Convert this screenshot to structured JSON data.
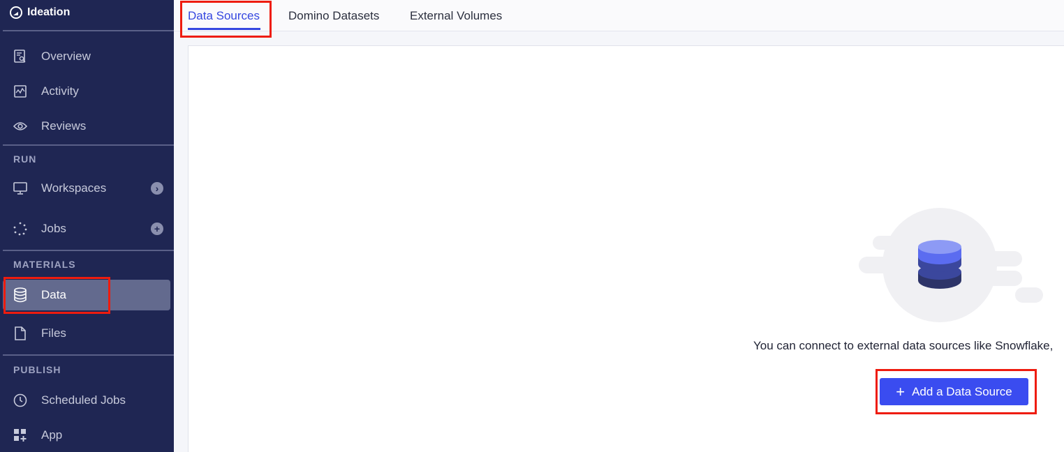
{
  "sidebar": {
    "brand": "Ideation",
    "items_top": [
      {
        "label": "Overview",
        "icon": "overview-icon"
      },
      {
        "label": "Activity",
        "icon": "activity-icon"
      },
      {
        "label": "Reviews",
        "icon": "eye-icon"
      }
    ],
    "sections": {
      "run": "RUN",
      "materials": "MATERIALS",
      "publish": "PUBLISH"
    },
    "run_items": [
      {
        "label": "Workspaces",
        "icon": "monitor-icon",
        "trailing": "chevron-right-icon"
      },
      {
        "label": "Jobs",
        "icon": "jobs-icon",
        "trailing": "plus-icon"
      }
    ],
    "materials_items": [
      {
        "label": "Data",
        "icon": "database-icon",
        "active": true
      },
      {
        "label": "Files",
        "icon": "file-icon"
      }
    ],
    "publish_items": [
      {
        "label": "Scheduled Jobs",
        "icon": "clock-icon"
      },
      {
        "label": "App",
        "icon": "app-icon"
      }
    ]
  },
  "tabs": [
    {
      "label": "Data Sources",
      "active": true
    },
    {
      "label": "Domino Datasets",
      "active": false
    },
    {
      "label": "External Volumes",
      "active": false
    }
  ],
  "empty_state": {
    "message": "You can connect to external data sources like Snowflake,",
    "button_label": "Add a Data Source",
    "button_icon": "plus-icon"
  },
  "colors": {
    "sidebar_bg": "#1f2653",
    "accent": "#3a4cf0",
    "highlight": "#ee1c0f"
  }
}
